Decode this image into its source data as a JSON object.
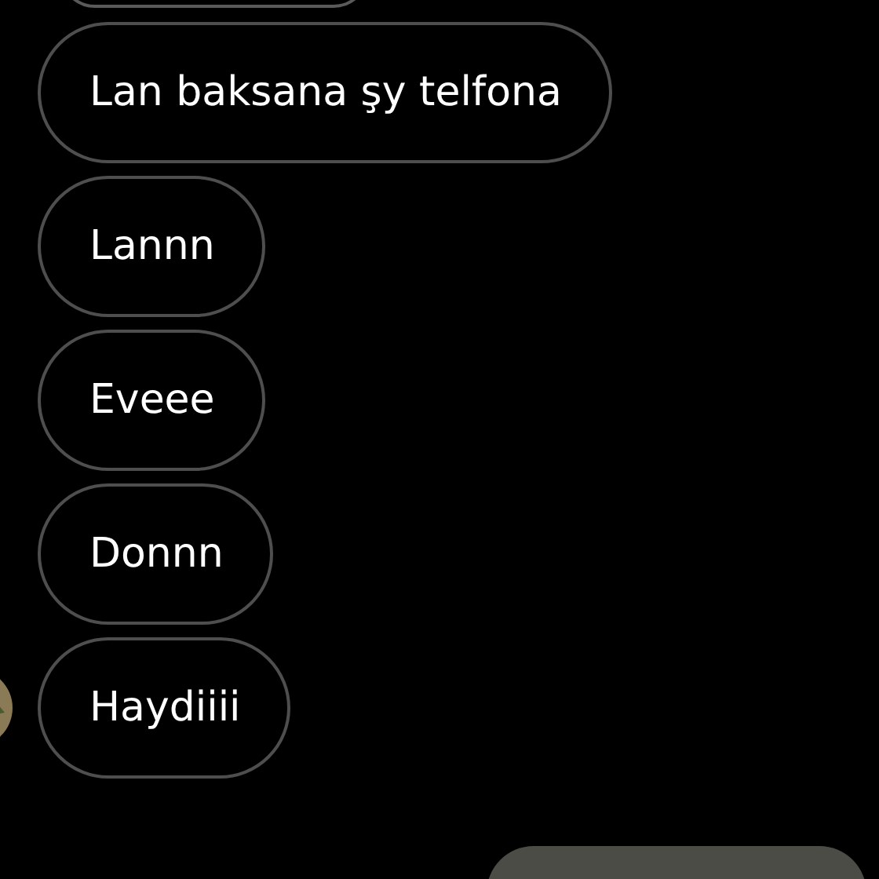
{
  "messages": [
    {
      "text": "Lan baksana şy telfona"
    },
    {
      "text": "Lannn"
    },
    {
      "text": "Eveee"
    },
    {
      "text": "Donnn"
    },
    {
      "text": "Haydiiii"
    }
  ]
}
